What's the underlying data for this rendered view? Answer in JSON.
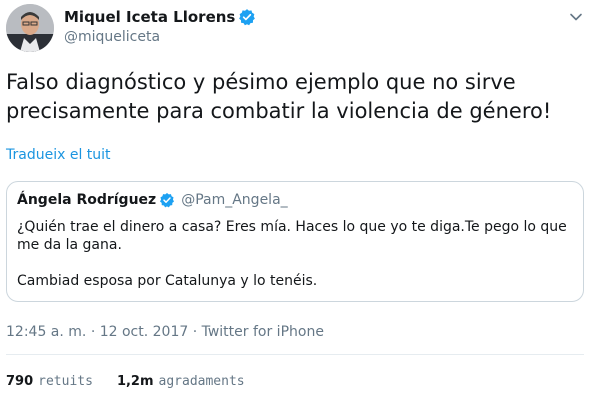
{
  "author": {
    "name": "Miquel Iceta Llorens",
    "handle": "@miqueliceta"
  },
  "tweet": {
    "text_line1": "Falso diagnóstico y pésimo ejemplo que no sirve",
    "text_line2": "precisamente para combatir la violencia de género!",
    "translate_label": "Tradueix el tuit"
  },
  "quoted": {
    "name": "Ángela Rodríguez",
    "handle": "@Pam_Angela_",
    "text_para1": "¿Quién trae el dinero a casa? Eres mía. Haces lo que yo te diga.Te pego lo que me da la gana.",
    "text_para2": "Cambiad esposa por Catalunya y lo tenéis."
  },
  "meta": {
    "timestamp": "12:45 a. m. · 12 oct. 2017 · Twitter for iPhone"
  },
  "stats": {
    "retweets_count": "790",
    "retweets_label": "retuits",
    "likes_count": "1,2m",
    "likes_label": "agradaments"
  },
  "colors": {
    "link_blue": "#1b95e0",
    "muted_gray": "#657786",
    "border": "#ccd6dd"
  },
  "icons": {
    "verified": "verified-badge-icon",
    "caret": "chevron-down-icon"
  }
}
